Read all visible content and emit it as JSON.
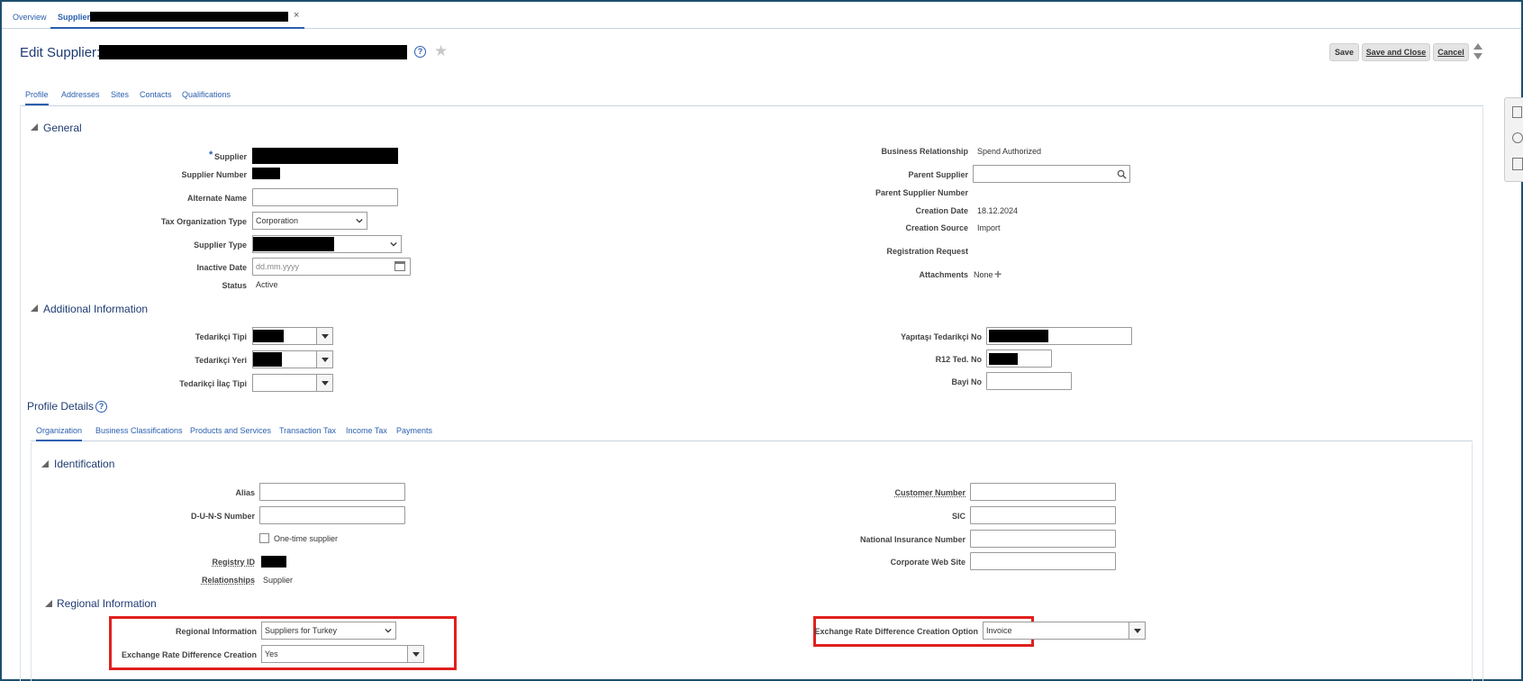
{
  "top_tabs": [
    {
      "label": "Overview"
    },
    {
      "label": "Supplier:"
    }
  ],
  "top_tab_close": "×",
  "header": {
    "title": "Edit Supplier:",
    "save": "Save",
    "save_and_close": "Save and Close",
    "cancel": "Cancel"
  },
  "main_tabs": [
    "Profile",
    "Addresses",
    "Sites",
    "Contacts",
    "Qualifications"
  ],
  "general": {
    "title": "General",
    "supplier_label": "Supplier",
    "required_mark": "*",
    "supplier_number_label": "Supplier Number",
    "alternate_name_label": "Alternate Name",
    "tax_org_type_label": "Tax Organization Type",
    "tax_org_type_value": "Corporation",
    "supplier_type_label": "Supplier Type",
    "inactive_date_label": "Inactive Date",
    "inactive_date_placeholder": "dd.mm.yyyy",
    "status_label": "Status",
    "status_value": "Active",
    "business_relationship_label": "Business Relationship",
    "business_relationship_value": "Spend Authorized",
    "parent_supplier_label": "Parent Supplier",
    "parent_supplier_number_label": "Parent Supplier Number",
    "creation_date_label": "Creation Date",
    "creation_date_value": "18.12.2024",
    "creation_source_label": "Creation Source",
    "creation_source_value": "Import",
    "registration_request_label": "Registration Request",
    "attachments_label": "Attachments",
    "attachments_value": "None"
  },
  "additional": {
    "title": "Additional Information",
    "tedarikci_tipi_label": "Tedarikçi Tipi",
    "tedarikci_yeri_label": "Tedarikçi Yeri",
    "tedarikci_ilac_tipi_label": "Tedarikçi İlaç Tipi",
    "yapitasi_label": "Yapıtaşı Tedarikçi No",
    "r12_label": "R12 Ted. No",
    "bayi_label": "Bayi No"
  },
  "profile_details": {
    "title": "Profile Details",
    "tabs": [
      "Organization",
      "Business Classifications",
      "Products and Services",
      "Transaction Tax",
      "Income Tax",
      "Payments"
    ]
  },
  "identification": {
    "title": "Identification",
    "alias_label": "Alias",
    "duns_label": "D-U-N-S Number",
    "one_time_label": "One-time supplier",
    "registry_id_label": "Registry ID",
    "relationships_label": "Relationships",
    "relationships_value": "Supplier",
    "customer_number_label": "Customer Number",
    "sic_label": "SIC",
    "national_insurance_label": "National Insurance Number",
    "corporate_web_label": "Corporate Web Site"
  },
  "regional": {
    "title": "Regional Information",
    "regional_info_label": "Regional Information",
    "regional_info_value": "Suppliers for Turkey",
    "exch_rate_diff_label": "Exchange Rate Difference Creation",
    "exch_rate_diff_value": "Yes",
    "exch_rate_option_label": "Exchange Rate Difference Creation Option",
    "exch_rate_option_value": "Invoice"
  },
  "colors": {
    "accent": "#2b5fae",
    "section_title": "#1f3b72",
    "highlight": "#e0201e"
  }
}
